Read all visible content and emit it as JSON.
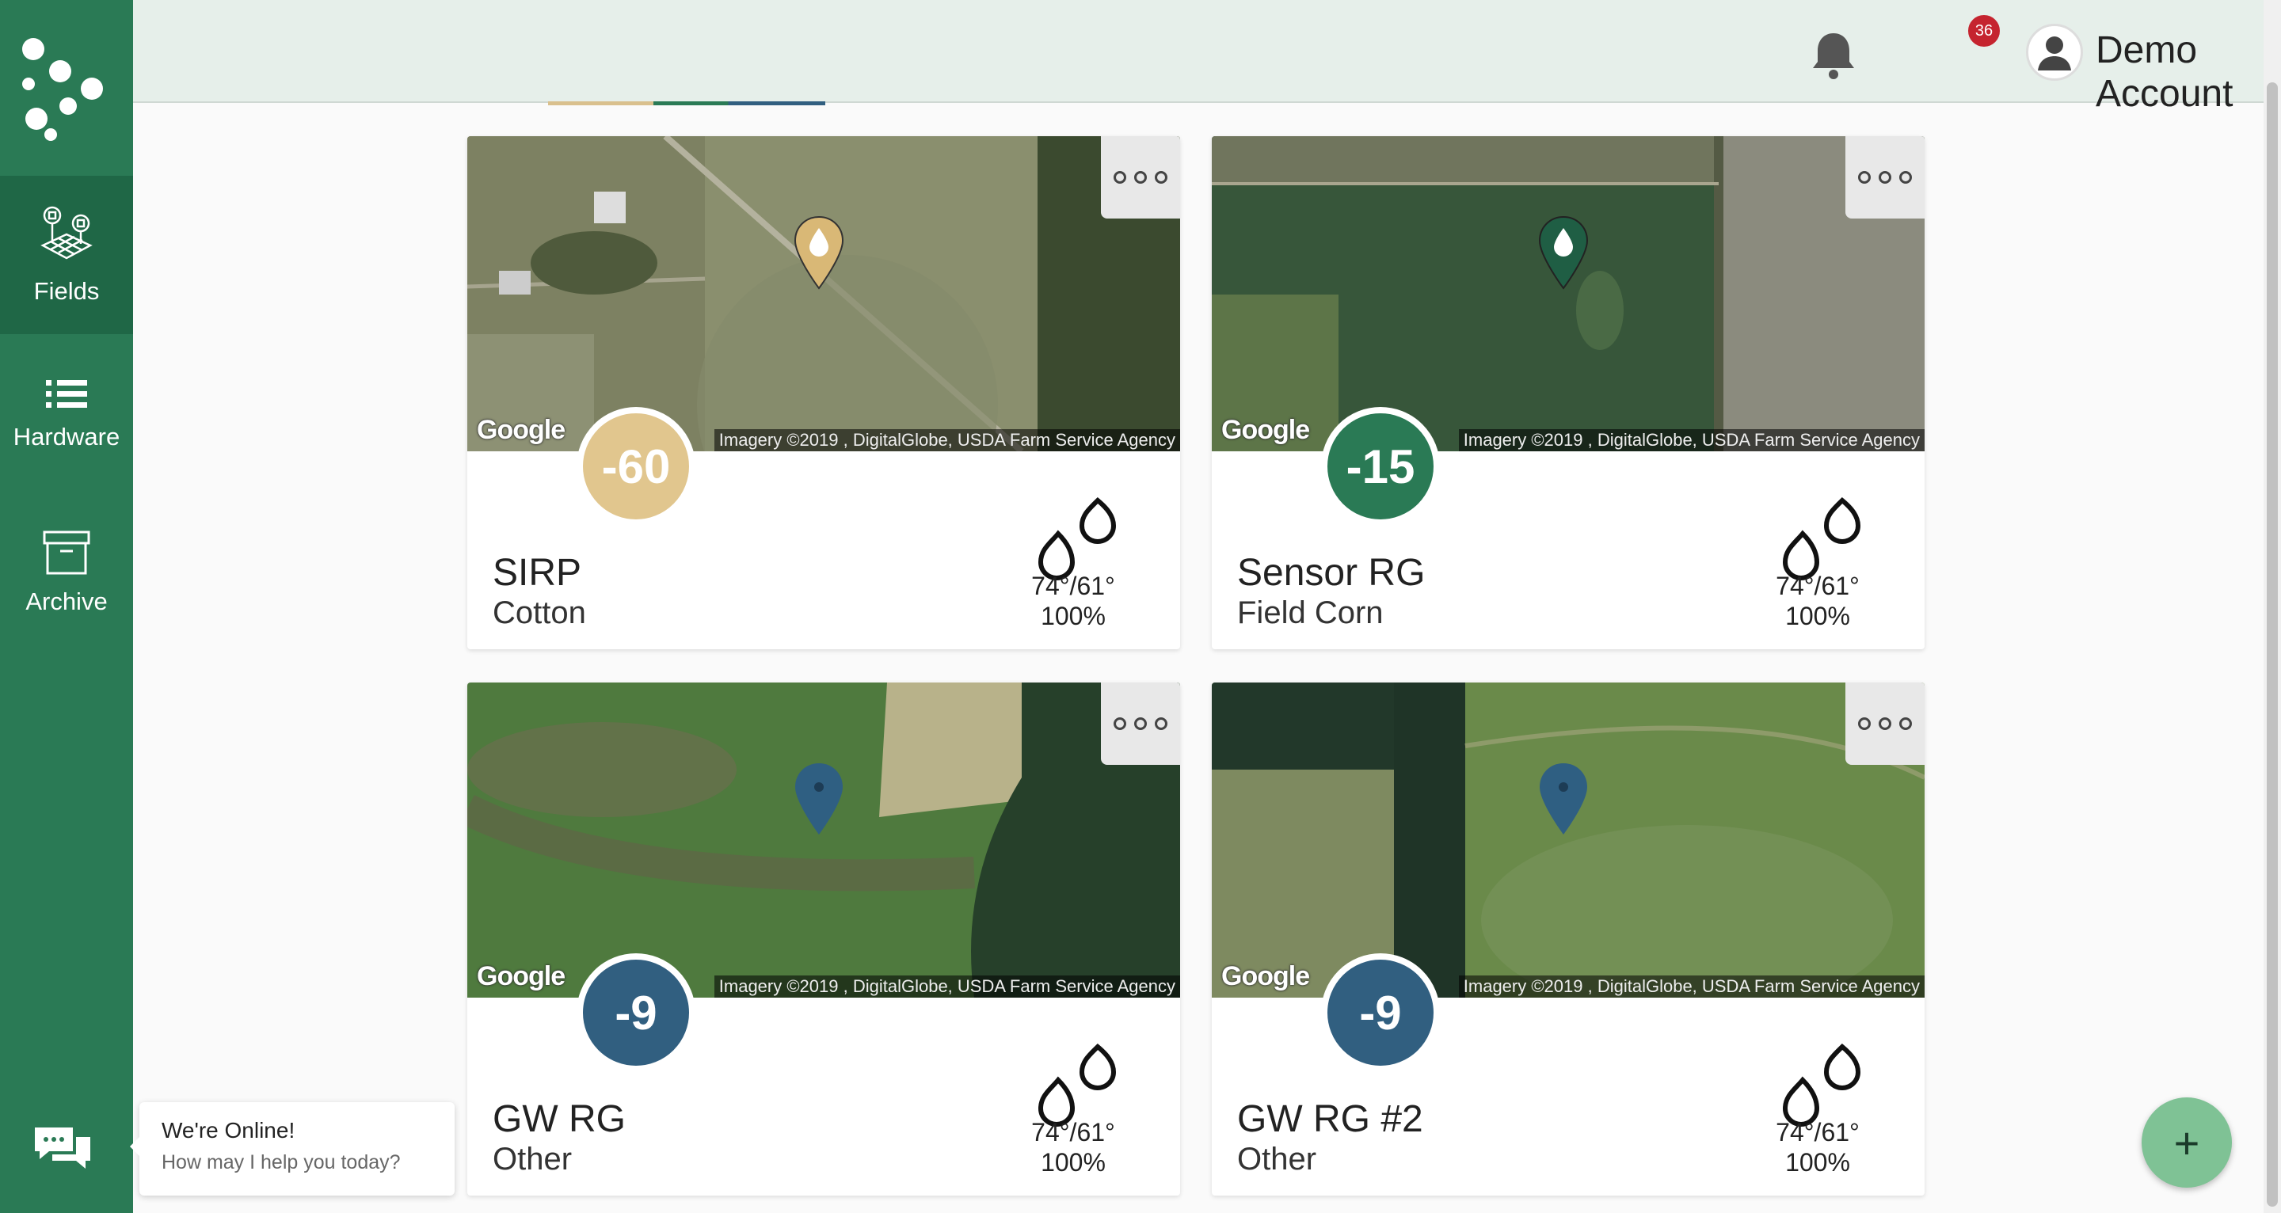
{
  "sidebar": {
    "items": [
      {
        "label": "Fields",
        "icon": "fields-icon",
        "active": true
      },
      {
        "label": "Hardware",
        "icon": "list-icon",
        "active": false
      },
      {
        "label": "Archive",
        "icon": "archive-icon",
        "active": false
      }
    ]
  },
  "header": {
    "notification_count": "36",
    "account_name": "Demo Account"
  },
  "fields": [
    {
      "name": "SIRP",
      "crop": "Cotton",
      "score": "-60",
      "score_color": "#e1c68e",
      "pin_color": "#d9b876",
      "temp": "74°/61°",
      "humidity": "100%",
      "attribution": "Imagery ©2019 , DigitalGlobe, USDA Farm Service Agency",
      "map_label": "Google"
    },
    {
      "name": "Sensor RG",
      "crop": "Field Corn",
      "score": "-15",
      "score_color": "#2a7a55",
      "pin_color": "#1f5e44",
      "temp": "74°/61°",
      "humidity": "100%",
      "attribution": "Imagery ©2019 , DigitalGlobe, USDA Farm Service Agency",
      "map_label": "Google"
    },
    {
      "name": "GW RG",
      "crop": "Other",
      "score": "-9",
      "score_color": "#315f80",
      "pin_color": "#2f5f82",
      "temp": "74°/61°",
      "humidity": "100%",
      "attribution": "Imagery ©2019 , DigitalGlobe, USDA Farm Service Agency",
      "map_label": "Google"
    },
    {
      "name": "GW RG #2",
      "crop": "Other",
      "score": "-9",
      "score_color": "#315f80",
      "pin_color": "#2f5f82",
      "temp": "74°/61°",
      "humidity": "100%",
      "attribution": "Imagery ©2019 , DigitalGlobe, USDA Farm Service Agency",
      "map_label": "Google"
    }
  ],
  "chat": {
    "title": "We're Online!",
    "subtitle": "How may I help you today?"
  },
  "fab_label": "+",
  "colors": {
    "sidebar": "#2a7a55",
    "header": "#e6efea",
    "badge": "#c5242f",
    "fab": "#7fc295"
  }
}
